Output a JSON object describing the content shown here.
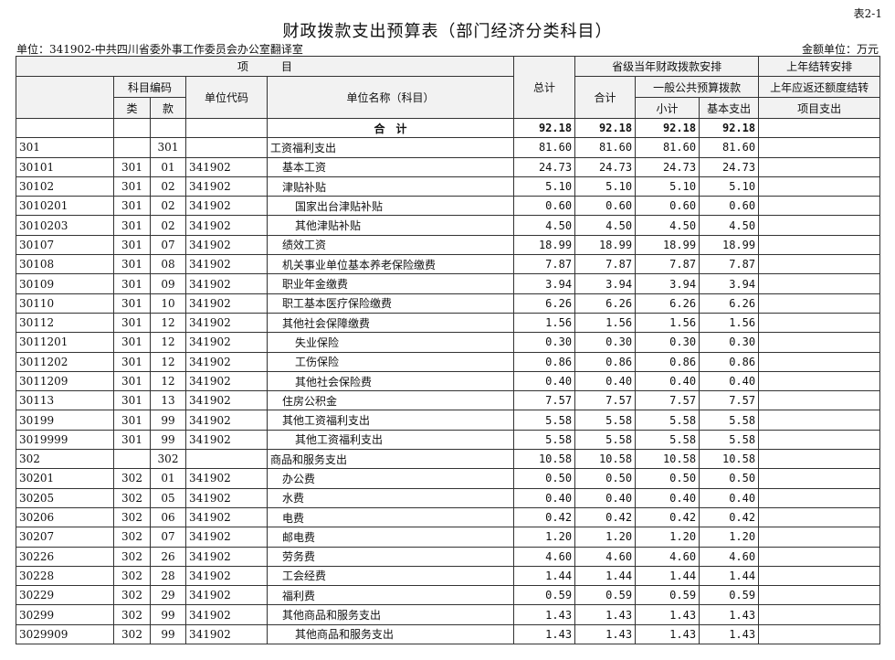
{
  "header": {
    "table_no": "表2-1",
    "title": "财政拨款支出预算表（部门经济分类科目）",
    "unit": "单位：341902-中共四川省委外事工作委员会办公室翻译室",
    "amount_unit": "金额单位：万元"
  },
  "columns": {
    "item": "项　　　目",
    "subject_code": "科目编码",
    "class": "类",
    "section": "款",
    "unit_code": "单位代码",
    "unit_name": "单位名称（科目）",
    "total": "总计",
    "prov_group": "省级当年财政拨款安排",
    "subtotal_all": "合计",
    "general_budget": "一般公共预算拨款",
    "subtotal": "小计",
    "basic": "基本支出",
    "carry_group": "上年结转安排",
    "carry_sub": "上年应返还额度结转",
    "project": "项目支出"
  },
  "total_row": {
    "label": "合　计",
    "total": "92.18",
    "sum": "92.18",
    "subtotal": "92.18",
    "basic": "92.18",
    "project": ""
  },
  "rows": [
    {
      "code": "301",
      "cls": "",
      "sec": "301",
      "unit": "",
      "name": "工资福利支出",
      "indent": 0,
      "total": "81.60",
      "sum": "81.60",
      "subtotal": "81.60",
      "basic": "81.60",
      "project": ""
    },
    {
      "code": "30101",
      "cls": "301",
      "sec": "01",
      "unit": "341902",
      "name": "基本工资",
      "indent": 1,
      "total": "24.73",
      "sum": "24.73",
      "subtotal": "24.73",
      "basic": "24.73",
      "project": ""
    },
    {
      "code": "30102",
      "cls": "301",
      "sec": "02",
      "unit": "341902",
      "name": "津贴补贴",
      "indent": 1,
      "total": "5.10",
      "sum": "5.10",
      "subtotal": "5.10",
      "basic": "5.10",
      "project": ""
    },
    {
      "code": "3010201",
      "cls": "301",
      "sec": "02",
      "unit": "341902",
      "name": "国家出台津贴补贴",
      "indent": 2,
      "total": "0.60",
      "sum": "0.60",
      "subtotal": "0.60",
      "basic": "0.60",
      "project": ""
    },
    {
      "code": "3010203",
      "cls": "301",
      "sec": "02",
      "unit": "341902",
      "name": "其他津贴补贴",
      "indent": 2,
      "total": "4.50",
      "sum": "4.50",
      "subtotal": "4.50",
      "basic": "4.50",
      "project": ""
    },
    {
      "code": "30107",
      "cls": "301",
      "sec": "07",
      "unit": "341902",
      "name": "绩效工资",
      "indent": 1,
      "total": "18.99",
      "sum": "18.99",
      "subtotal": "18.99",
      "basic": "18.99",
      "project": ""
    },
    {
      "code": "30108",
      "cls": "301",
      "sec": "08",
      "unit": "341902",
      "name": "机关事业单位基本养老保险缴费",
      "indent": 1,
      "total": "7.87",
      "sum": "7.87",
      "subtotal": "7.87",
      "basic": "7.87",
      "project": ""
    },
    {
      "code": "30109",
      "cls": "301",
      "sec": "09",
      "unit": "341902",
      "name": "职业年金缴费",
      "indent": 1,
      "total": "3.94",
      "sum": "3.94",
      "subtotal": "3.94",
      "basic": "3.94",
      "project": ""
    },
    {
      "code": "30110",
      "cls": "301",
      "sec": "10",
      "unit": "341902",
      "name": "职工基本医疗保险缴费",
      "indent": 1,
      "total": "6.26",
      "sum": "6.26",
      "subtotal": "6.26",
      "basic": "6.26",
      "project": ""
    },
    {
      "code": "30112",
      "cls": "301",
      "sec": "12",
      "unit": "341902",
      "name": "其他社会保障缴费",
      "indent": 1,
      "total": "1.56",
      "sum": "1.56",
      "subtotal": "1.56",
      "basic": "1.56",
      "project": ""
    },
    {
      "code": "3011201",
      "cls": "301",
      "sec": "12",
      "unit": "341902",
      "name": "失业保险",
      "indent": 2,
      "total": "0.30",
      "sum": "0.30",
      "subtotal": "0.30",
      "basic": "0.30",
      "project": ""
    },
    {
      "code": "3011202",
      "cls": "301",
      "sec": "12",
      "unit": "341902",
      "name": "工伤保险",
      "indent": 2,
      "total": "0.86",
      "sum": "0.86",
      "subtotal": "0.86",
      "basic": "0.86",
      "project": ""
    },
    {
      "code": "3011209",
      "cls": "301",
      "sec": "12",
      "unit": "341902",
      "name": "其他社会保险费",
      "indent": 2,
      "total": "0.40",
      "sum": "0.40",
      "subtotal": "0.40",
      "basic": "0.40",
      "project": ""
    },
    {
      "code": "30113",
      "cls": "301",
      "sec": "13",
      "unit": "341902",
      "name": "住房公积金",
      "indent": 1,
      "total": "7.57",
      "sum": "7.57",
      "subtotal": "7.57",
      "basic": "7.57",
      "project": ""
    },
    {
      "code": "30199",
      "cls": "301",
      "sec": "99",
      "unit": "341902",
      "name": "其他工资福利支出",
      "indent": 1,
      "total": "5.58",
      "sum": "5.58",
      "subtotal": "5.58",
      "basic": "5.58",
      "project": ""
    },
    {
      "code": "3019999",
      "cls": "301",
      "sec": "99",
      "unit": "341902",
      "name": "其他工资福利支出",
      "indent": 2,
      "total": "5.58",
      "sum": "5.58",
      "subtotal": "5.58",
      "basic": "5.58",
      "project": ""
    },
    {
      "code": "302",
      "cls": "",
      "sec": "302",
      "unit": "",
      "name": "商品和服务支出",
      "indent": 0,
      "total": "10.58",
      "sum": "10.58",
      "subtotal": "10.58",
      "basic": "10.58",
      "project": ""
    },
    {
      "code": "30201",
      "cls": "302",
      "sec": "01",
      "unit": "341902",
      "name": "办公费",
      "indent": 1,
      "total": "0.50",
      "sum": "0.50",
      "subtotal": "0.50",
      "basic": "0.50",
      "project": ""
    },
    {
      "code": "30205",
      "cls": "302",
      "sec": "05",
      "unit": "341902",
      "name": "水费",
      "indent": 1,
      "total": "0.40",
      "sum": "0.40",
      "subtotal": "0.40",
      "basic": "0.40",
      "project": ""
    },
    {
      "code": "30206",
      "cls": "302",
      "sec": "06",
      "unit": "341902",
      "name": "电费",
      "indent": 1,
      "total": "0.42",
      "sum": "0.42",
      "subtotal": "0.42",
      "basic": "0.42",
      "project": ""
    },
    {
      "code": "30207",
      "cls": "302",
      "sec": "07",
      "unit": "341902",
      "name": "邮电费",
      "indent": 1,
      "total": "1.20",
      "sum": "1.20",
      "subtotal": "1.20",
      "basic": "1.20",
      "project": ""
    },
    {
      "code": "30226",
      "cls": "302",
      "sec": "26",
      "unit": "341902",
      "name": "劳务费",
      "indent": 1,
      "total": "4.60",
      "sum": "4.60",
      "subtotal": "4.60",
      "basic": "4.60",
      "project": ""
    },
    {
      "code": "30228",
      "cls": "302",
      "sec": "28",
      "unit": "341902",
      "name": "工会经费",
      "indent": 1,
      "total": "1.44",
      "sum": "1.44",
      "subtotal": "1.44",
      "basic": "1.44",
      "project": ""
    },
    {
      "code": "30229",
      "cls": "302",
      "sec": "29",
      "unit": "341902",
      "name": "福利费",
      "indent": 1,
      "total": "0.59",
      "sum": "0.59",
      "subtotal": "0.59",
      "basic": "0.59",
      "project": ""
    },
    {
      "code": "30299",
      "cls": "302",
      "sec": "99",
      "unit": "341902",
      "name": "其他商品和服务支出",
      "indent": 1,
      "total": "1.43",
      "sum": "1.43",
      "subtotal": "1.43",
      "basic": "1.43",
      "project": ""
    },
    {
      "code": "3029909",
      "cls": "302",
      "sec": "99",
      "unit": "341902",
      "name": "其他商品和服务支出",
      "indent": 2,
      "total": "1.43",
      "sum": "1.43",
      "subtotal": "1.43",
      "basic": "1.43",
      "project": ""
    }
  ]
}
